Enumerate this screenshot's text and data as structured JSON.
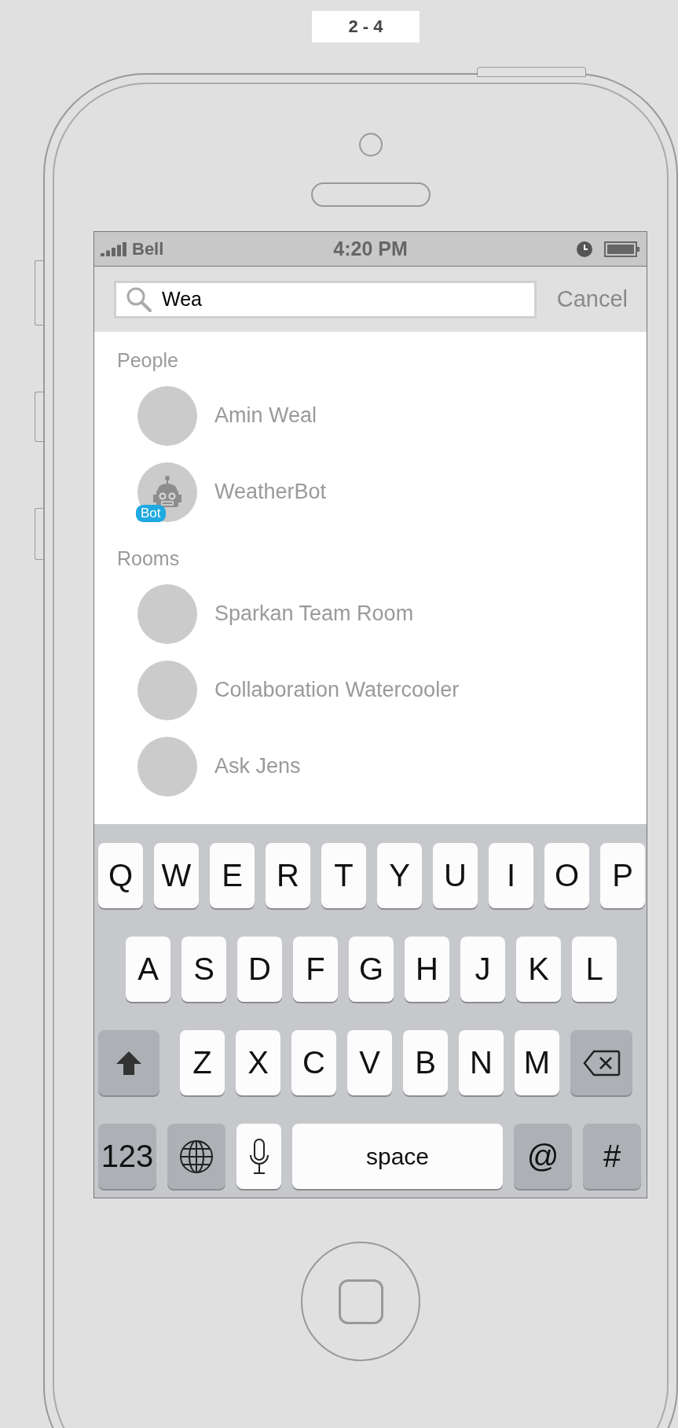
{
  "page_label": "2 - 4",
  "status_bar": {
    "carrier": "Bell",
    "time": "4:20 PM"
  },
  "search": {
    "value": "Wea",
    "cancel": "Cancel"
  },
  "sections": [
    {
      "title": "People",
      "items": [
        {
          "name": "Amin Weal",
          "kind": "plain"
        },
        {
          "name": "WeatherBot",
          "kind": "bot",
          "badge": "Bot"
        }
      ]
    },
    {
      "title": "Rooms",
      "items": [
        {
          "name": "Sparkan Team Room",
          "kind": "plain"
        },
        {
          "name": "Collaboration Watercooler",
          "kind": "plain"
        },
        {
          "name": "Ask Jens",
          "kind": "plain"
        }
      ]
    }
  ],
  "keyboard": {
    "rows": [
      {
        "keys": [
          {
            "kind": "letter",
            "label": "Q"
          },
          {
            "kind": "letter",
            "label": "W"
          },
          {
            "kind": "letter",
            "label": "E"
          },
          {
            "kind": "letter",
            "label": "R"
          },
          {
            "kind": "letter",
            "label": "T"
          },
          {
            "kind": "letter",
            "label": "Y"
          },
          {
            "kind": "letter",
            "label": "U"
          },
          {
            "kind": "letter",
            "label": "I"
          },
          {
            "kind": "letter",
            "label": "O"
          },
          {
            "kind": "letter",
            "label": "P"
          }
        ]
      },
      {
        "keys": [
          {
            "kind": "letter",
            "label": "A"
          },
          {
            "kind": "letter",
            "label": "S"
          },
          {
            "kind": "letter",
            "label": "D"
          },
          {
            "kind": "letter",
            "label": "F"
          },
          {
            "kind": "letter",
            "label": "G"
          },
          {
            "kind": "letter",
            "label": "H"
          },
          {
            "kind": "letter",
            "label": "J"
          },
          {
            "kind": "letter",
            "label": "K"
          },
          {
            "kind": "letter",
            "label": "L"
          }
        ]
      },
      {
        "keys": [
          {
            "kind": "shift"
          },
          {
            "kind": "letter",
            "label": "Z"
          },
          {
            "kind": "letter",
            "label": "X"
          },
          {
            "kind": "letter",
            "label": "C"
          },
          {
            "kind": "letter",
            "label": "V"
          },
          {
            "kind": "letter",
            "label": "B"
          },
          {
            "kind": "letter",
            "label": "N"
          },
          {
            "kind": "letter",
            "label": "M"
          },
          {
            "kind": "delete"
          }
        ]
      },
      {
        "keys": [
          {
            "kind": "function",
            "label": "123"
          },
          {
            "kind": "globe"
          },
          {
            "kind": "mic"
          },
          {
            "kind": "space",
            "label": "space"
          },
          {
            "kind": "function",
            "label": "@"
          },
          {
            "kind": "function",
            "label": "#"
          }
        ]
      }
    ]
  }
}
